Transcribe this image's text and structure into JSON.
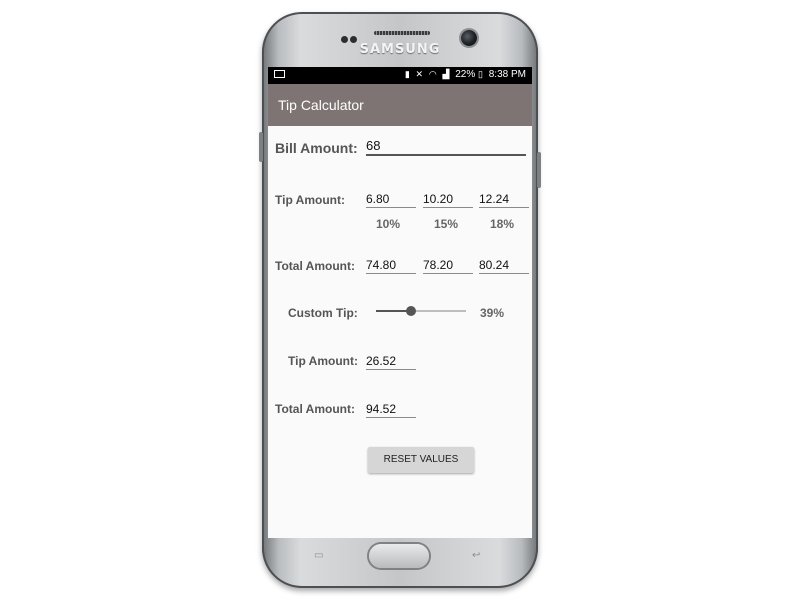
{
  "device": {
    "brand": "SAMSUNG"
  },
  "statusbar": {
    "battery": "22%",
    "time": "8:38 PM",
    "icons": [
      "image-icon",
      "battery-saver-icon",
      "mute-icon",
      "wifi-icon",
      "signal-icon",
      "battery-icon"
    ]
  },
  "appbar": {
    "title": "Tip Calculator"
  },
  "bill": {
    "label": "Bill Amount:",
    "value": "68"
  },
  "tip_row": {
    "label": "Tip Amount:",
    "values": [
      "6.80",
      "10.20",
      "12.24"
    ],
    "percents": [
      "10%",
      "15%",
      "18%"
    ]
  },
  "total_row": {
    "label": "Total Amount:",
    "values": [
      "74.80",
      "78.20",
      "80.24"
    ]
  },
  "custom": {
    "label": "Custom Tip:",
    "percent_text": "39%",
    "slider_fraction": 0.39
  },
  "custom_tip": {
    "label": "Tip Amount:",
    "value": "26.52"
  },
  "custom_total": {
    "label": "Total Amount:",
    "value": "94.52"
  },
  "reset_button": {
    "label": "RESET VALUES"
  }
}
